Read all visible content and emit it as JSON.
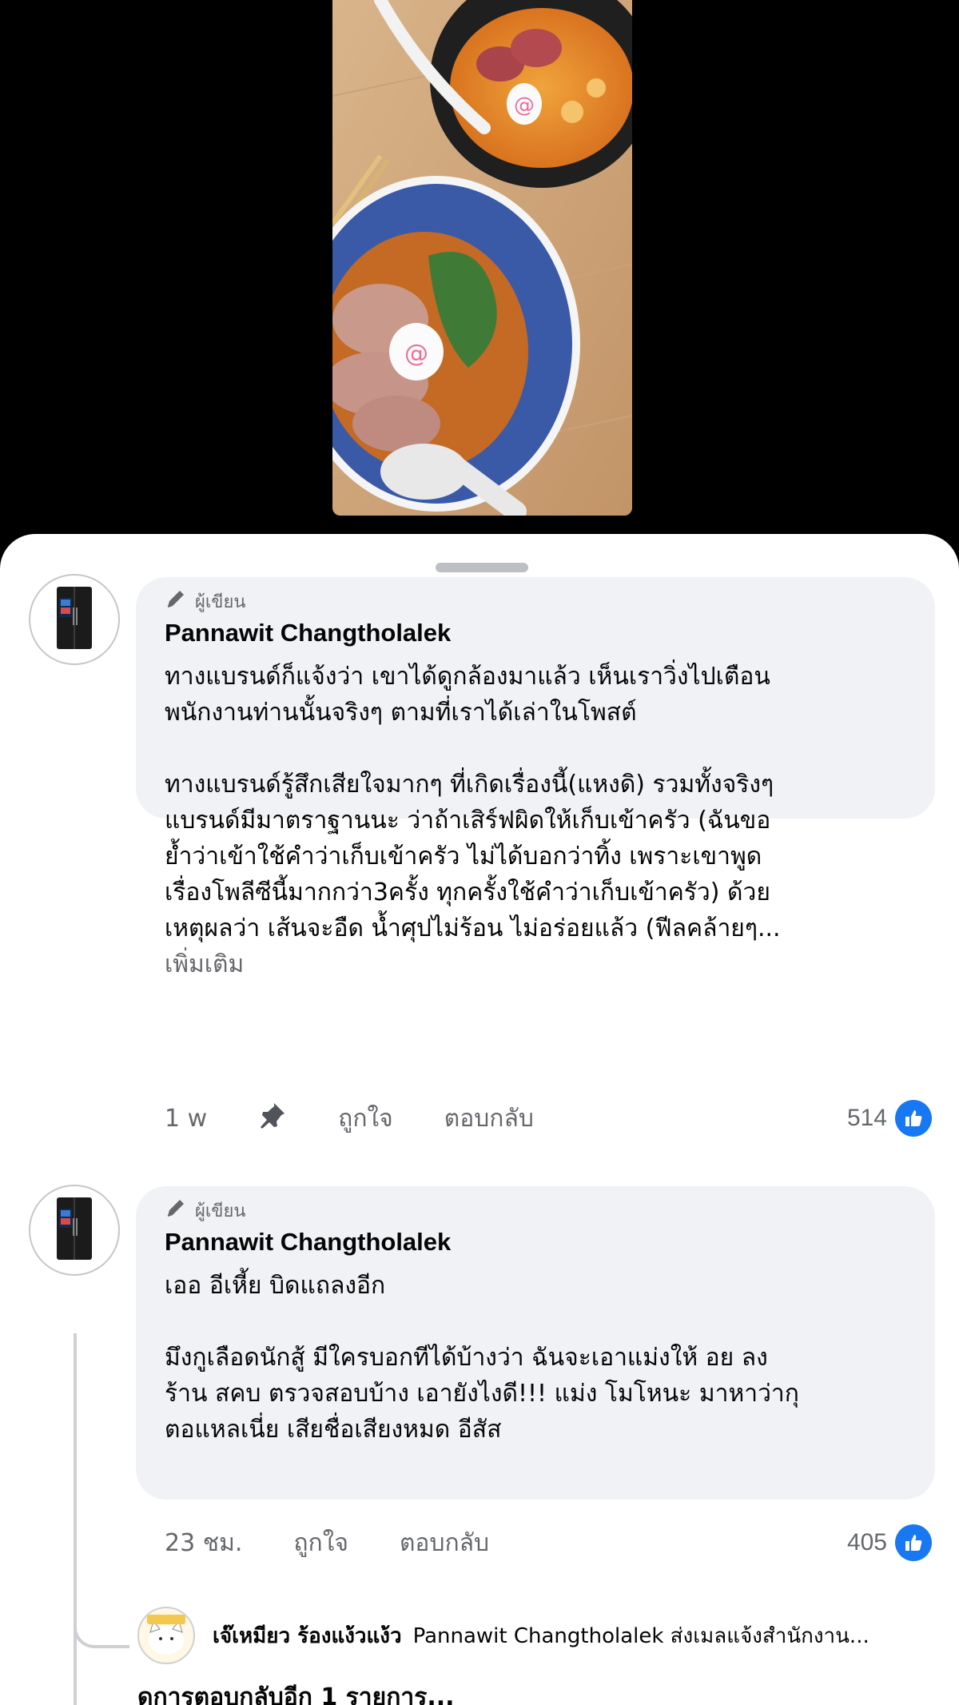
{
  "comments": [
    {
      "author_tag": "ผู้เขียน",
      "author": "Pannawit Changtholalek",
      "paragraphs": [
        [
          "ทางแบรนด์ก็แจ้งว่า เขาได้ดูกล้องมาแล้ว เห็นเราวิ่งไปเตือน",
          "พนักงานท่านนั้นจริงๆ ตามที่เราได้เล่าในโพสต์"
        ],
        [
          "ทางแบรนด์รู้สึกเสียใจมากๆ ที่เกิดเรื่องนี้(แหงดิ) รวมทั้งจริงๆ",
          "แบรนด์มีมาตราฐานนะ ว่าถ้าเสิร์ฟผิดให้เก็บเข้าครัว (ฉันขอ",
          "ย้ำว่าเข้าใช้คำว่าเก็บเข้าครัว ไม่ได้บอกว่าทิ้ง เพราะเขาพูด",
          "เรื่องโพลีซีนี้มากกว่า3ครั้ง ทุกครั้งใช้คำว่าเก็บเข้าครัว) ด้วย",
          "เหตุผลว่า เส้นจะอืด น้ำศุปไม่ร้อน ไม่อร่อยแล้ว (ฟีลคล้ายๆ..."
        ]
      ],
      "see_more": "เพิ่มเติม",
      "time": "1 w",
      "like": "ถูกใจ",
      "reply": "ตอบกลับ",
      "reactions": "514"
    },
    {
      "author_tag": "ผู้เขียน",
      "author": "Pannawit Changtholalek",
      "paragraphs": [
        [
          "เออ อีเหี้ย บิดแถลงอีก"
        ],
        [
          "มึงกูเลือดนักสู้ มีใครบอกทีได้บ้างว่า ฉันจะเอาแม่งให้ อย ลง",
          "ร้าน สคบ ตรวจสอบบ้าง เอายังไงดี!!! แม่ง โมโหนะ มาหาว่ากุ",
          "ตอแหลเนี่ย เสียชื่อเสียงหมด อีสัส"
        ]
      ],
      "time": "23 ชม.",
      "like": "ถูกใจ",
      "reply": "ตอบกลับ",
      "reactions": "405"
    }
  ],
  "nested_reply": {
    "name": "เจ๊เหมียว ร้องแง้วแง้ว",
    "text": "Pannawit Changtholalek ส่งเมลแจ้งสำนักงาน..."
  },
  "more_replies": "ดูการตอบกลับอีก 1 รายการ...",
  "colors": {
    "like_blue": "#1877f2",
    "bubble_bg": "#f0f2f5",
    "meta_gray": "#65676b"
  },
  "icons": [
    "pencil-icon",
    "pin-icon",
    "like-thumb-icon",
    "refrigerator-avatar"
  ]
}
